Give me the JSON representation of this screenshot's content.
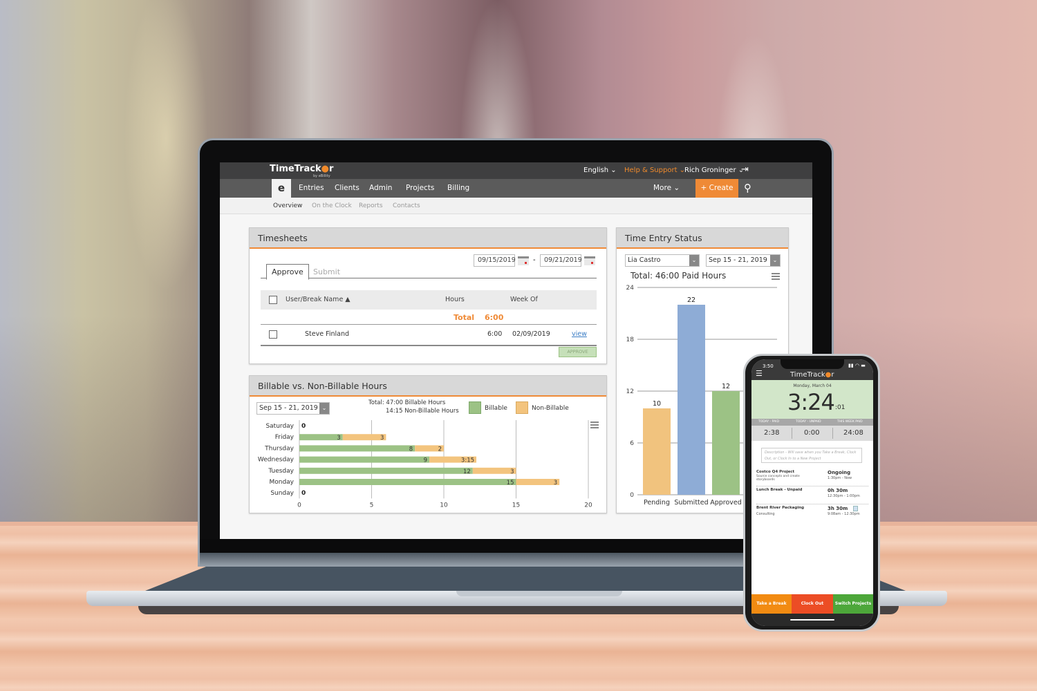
{
  "app": {
    "logo": "TimeTracker",
    "logo_sub": "by eBillity",
    "topbar": {
      "language": "English ⌄",
      "help": "Help & Support ⌄",
      "user": "Rich Groninger ⌄",
      "logout_icon": "logout-icon"
    },
    "nav": {
      "home_icon": "e-clock-icon",
      "items": [
        "Entries",
        "Clients",
        "Admin",
        "Projects",
        "Billing"
      ],
      "more": "More ⌄",
      "create": "+ Create",
      "search_icon": "search-icon"
    },
    "subnav": [
      "Overview",
      "On the Clock",
      "Reports",
      "Contacts"
    ],
    "colors": {
      "accent": "#ef8a36",
      "billable": "#9cc285",
      "non_billable": "#f3c47e",
      "submitted": "#8eacd6",
      "pending": "#f1c37e",
      "approved": "#9cc285"
    }
  },
  "timesheets": {
    "title": "Timesheets",
    "date_from": "09/15/2019",
    "date_sep": "-",
    "date_to": "09/21/2019",
    "tabs": [
      "Approve",
      "Submit"
    ],
    "columns": [
      "User/Break Name ▲",
      "Hours",
      "Week Of"
    ],
    "total_label": "Total",
    "total_value": "6:00",
    "rows": [
      {
        "name": "Steve Finland",
        "hours": "6:00",
        "week_of": "02/09/2019",
        "link": "view"
      }
    ],
    "approve_button": "APPROVE"
  },
  "billable": {
    "title": "Billable vs. Non-Billable Hours",
    "range": "Sep 15 - 21, 2019",
    "total_line1": "Total: 47:00 Billable Hours",
    "total_line2": "14:15 Non-Billable Hours"
  },
  "status": {
    "title": "Time Entry Status",
    "user": "Lia Castro",
    "range": "Sep 15 - 21, 2019",
    "total": "Total: 46:00 Paid Hours"
  },
  "chart_data": [
    {
      "type": "bar",
      "orientation": "horizontal-stacked",
      "title": "Billable vs. Non-Billable Hours",
      "categories": [
        "Saturday",
        "Friday",
        "Thursday",
        "Wednesday",
        "Tuesday",
        "Monday",
        "Sunday"
      ],
      "series": [
        {
          "name": "Billable",
          "values": [
            0,
            3,
            8,
            9,
            12,
            15,
            0
          ],
          "labels": [
            "0",
            "3",
            "8",
            "9",
            "12",
            "15",
            "0"
          ]
        },
        {
          "name": "Non-Billable",
          "values": [
            0,
            3,
            2,
            3.25,
            3,
            3,
            0
          ],
          "labels": [
            "",
            "3",
            "2",
            "3:15",
            "3",
            "3",
            ""
          ]
        }
      ],
      "xticks": [
        "0",
        "5",
        "10",
        "15",
        "20"
      ],
      "xlim": [
        0,
        20
      ],
      "grid": true,
      "legend": "top-right"
    },
    {
      "type": "bar",
      "title": "Total: 46:00 Paid Hours",
      "categories": [
        "Pending",
        "Submitted",
        "Approved"
      ],
      "values": [
        10,
        22,
        12
      ],
      "yticks": [
        "0",
        "6",
        "12",
        "18",
        "24"
      ],
      "ylim": [
        0,
        24
      ],
      "grid": true
    }
  ],
  "phone": {
    "time": "3:50",
    "logo": "TimeTracker",
    "date": "Monday, March 04",
    "clock": "3:24",
    "clock_sec": ":01",
    "stat_labels": [
      "TODAY - PAID",
      "TODAY - UNPAID",
      "THIS WEEK PAID"
    ],
    "stat_values": [
      "2:38",
      "0:00",
      "24:08"
    ],
    "description_placeholder": "Description - Will save when you Take a Break, Clock Out, or Clock In to a New Project",
    "entries": [
      {
        "title": "Costco Q4 Project",
        "sub": "Source concepts and create storyboards",
        "duration": "Ongoing",
        "range": "1:30pm - Now"
      },
      {
        "title": "Lunch Break - Unpaid",
        "sub": "",
        "duration": "0h 30m",
        "range": "12:30pm - 1:00pm"
      },
      {
        "title": "Brent River Packaging",
        "sub": "Consulting",
        "duration": "3h 30m",
        "range": "9:08am - 12:30pm"
      }
    ],
    "buttons": [
      "Take a Break",
      "Clock Out",
      "Switch Projects"
    ]
  }
}
